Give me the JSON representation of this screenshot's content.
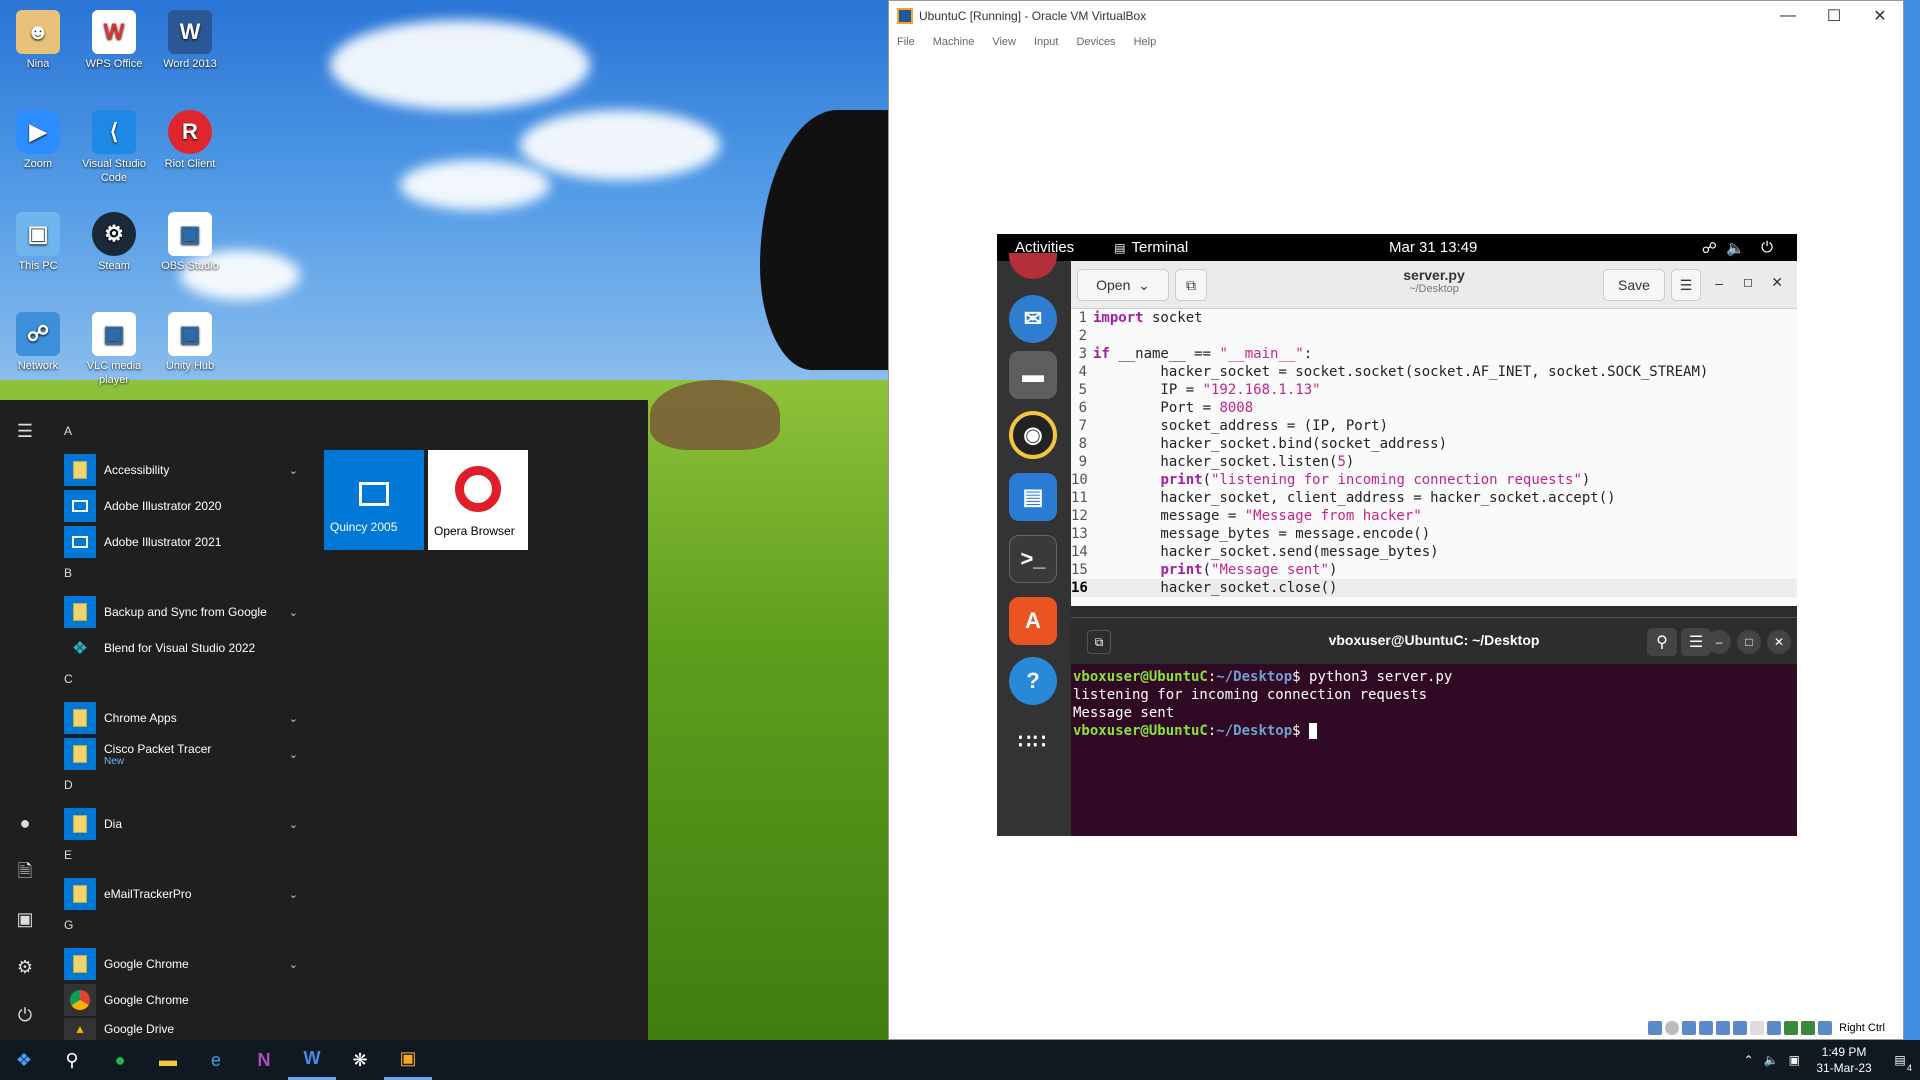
{
  "desktop": {
    "icons": [
      {
        "label": "Nina"
      },
      {
        "label": "WPS Office"
      },
      {
        "label": "Word 2013"
      },
      {
        "label": "Zoom"
      },
      {
        "label": "Visual Studio Code"
      },
      {
        "label": "Riot Client"
      },
      {
        "label": "This PC"
      },
      {
        "label": "Steam"
      },
      {
        "label": "OBS Studio"
      },
      {
        "label": "Network"
      },
      {
        "label": "VLC media player"
      },
      {
        "label": "Unity Hub"
      }
    ]
  },
  "start_menu": {
    "letters": {
      "a": "A",
      "b": "B",
      "c": "C",
      "d": "D",
      "e": "E",
      "g": "G"
    },
    "items": [
      {
        "label": "Accessibility"
      },
      {
        "label": "Adobe Illustrator 2020"
      },
      {
        "label": "Adobe Illustrator 2021"
      },
      {
        "label": "Backup and Sync from Google"
      },
      {
        "label": "Blend for Visual Studio 2022"
      },
      {
        "label": "Chrome Apps"
      },
      {
        "label": "Cisco Packet Tracer",
        "badge": "New"
      },
      {
        "label": "Dia"
      },
      {
        "label": "eMailTrackerPro"
      },
      {
        "label": "Google Chrome"
      },
      {
        "label": "Google Chrome"
      },
      {
        "label": "Google Drive"
      }
    ],
    "tiles": [
      {
        "label": "Quincy 2005"
      },
      {
        "label": "Opera Browser"
      }
    ]
  },
  "taskbar": {
    "time": "1:49 PM",
    "date": "31-Mar-23",
    "notification_count": "4"
  },
  "virtualbox": {
    "title": "UbuntuC [Running] - Oracle VM VirtualBox",
    "menu": [
      "File",
      "Machine",
      "View",
      "Input",
      "Devices",
      "Help"
    ],
    "status_right": "Right Ctrl"
  },
  "ubuntu": {
    "activities": "Activities",
    "app_name": "Terminal",
    "datetime": "Mar 31  13:49",
    "gedit": {
      "open_label": "Open",
      "save_label": "Save",
      "filename": "server.py",
      "path": "~/Desktop",
      "lines": [
        {
          "n": "1",
          "text": "import socket"
        },
        {
          "n": "2",
          "text": ""
        },
        {
          "n": "3",
          "text": "if __name__ == \"__main__\":"
        },
        {
          "n": "4",
          "text": "        hacker_socket = socket.socket(socket.AF_INET, socket.SOCK_STREAM)"
        },
        {
          "n": "5",
          "text": "        IP = \"192.168.1.13\""
        },
        {
          "n": "6",
          "text": "        Port = 8008"
        },
        {
          "n": "7",
          "text": "        socket_address = (IP, Port)"
        },
        {
          "n": "8",
          "text": "        hacker_socket.bind(socket_address)"
        },
        {
          "n": "9",
          "text": "        hacker_socket.listen(5)"
        },
        {
          "n": "10",
          "text": "        print(\"listening for incoming connection requests\")"
        },
        {
          "n": "11",
          "text": "        hacker_socket, client_address = hacker_socket.accept()"
        },
        {
          "n": "12",
          "text": "        message = \"Message from hacker\""
        },
        {
          "n": "13",
          "text": "        message_bytes = message.encode()"
        },
        {
          "n": "14",
          "text": "        hacker_socket.send(message_bytes)"
        },
        {
          "n": "15",
          "text": "        print(\"Message sent\")"
        },
        {
          "n": "16",
          "text": "        hacker_socket.close()"
        }
      ]
    },
    "terminal": {
      "title": "vboxuser@UbuntuC: ~/Desktop",
      "user": "vboxuser@UbuntuC",
      "path": "~/Desktop",
      "command": "python3 server.py",
      "output": [
        "listening for incoming connection requests",
        "Message sent"
      ]
    }
  }
}
